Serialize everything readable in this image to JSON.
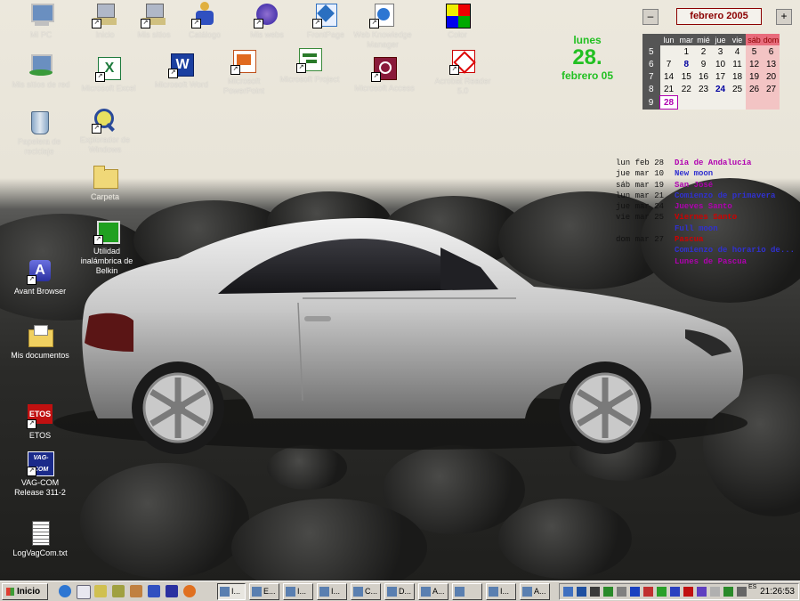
{
  "desktop_icons": [
    {
      "id": "mi-pc",
      "label": "Mi PC",
      "x": 0
    },
    {
      "id": "inicio",
      "label": "Inicio"
    },
    {
      "id": "mis-sitios",
      "label": "Mis sitios"
    },
    {
      "id": "catalogo",
      "label": "Catálogo"
    },
    {
      "id": "mis-webs",
      "label": "Mis webs"
    },
    {
      "id": "frontpage",
      "label": "FrontPage"
    },
    {
      "id": "web-knowledge",
      "label": "Web Knowledge Manager"
    },
    {
      "id": "color",
      "label": "Color"
    },
    {
      "id": "mis-sitios-red",
      "label": "Mis sitios de red"
    },
    {
      "id": "excel",
      "label": "Microsoft Excel"
    },
    {
      "id": "word",
      "label": "Microsoft Word"
    },
    {
      "id": "powerpoint",
      "label": "Microsoft PowerPoint"
    },
    {
      "id": "project",
      "label": "Microsoft Project"
    },
    {
      "id": "access",
      "label": "Microsoft Access"
    },
    {
      "id": "acrobat",
      "label": "Acrobat Reader 5.0"
    },
    {
      "id": "papelera",
      "label": "Papelera de reciclaje"
    },
    {
      "id": "explorador",
      "label": "Explorador de Windows"
    },
    {
      "id": "carpeta",
      "label": "Carpeta"
    },
    {
      "id": "utilidad",
      "label": "Utilidad inalámbrica de Belkin"
    },
    {
      "id": "avant",
      "label": "Avant Browser"
    },
    {
      "id": "mis-documentos",
      "label": "Mis documentos"
    },
    {
      "id": "etos",
      "label": "ETOS",
      "glyph": "ETOS"
    },
    {
      "id": "vagcom",
      "label": "VAG-COM Release 311-2",
      "glyph": "VAG-COM"
    },
    {
      "id": "logvag",
      "label": "LogVagCom.txt"
    }
  ],
  "calendar": {
    "month_label": "febrero 2005",
    "prev": "–",
    "next": "+",
    "weekdays": [
      "lun",
      "mar",
      "mié",
      "jue",
      "vie",
      "sáb",
      "dom"
    ],
    "weeks": [
      {
        "wk": "5",
        "days": [
          "",
          "1",
          "2",
          "3",
          "4",
          "5",
          "6"
        ]
      },
      {
        "wk": "6",
        "days": [
          "7",
          "8",
          "9",
          "10",
          "11",
          "12",
          "13"
        ]
      },
      {
        "wk": "7",
        "days": [
          "14",
          "15",
          "16",
          "17",
          "18",
          "19",
          "20"
        ]
      },
      {
        "wk": "8",
        "days": [
          "21",
          "22",
          "23",
          "24",
          "25",
          "26",
          "27"
        ]
      },
      {
        "wk": "9",
        "days": [
          "28",
          "",
          "",
          "",
          "",
          "",
          ""
        ]
      }
    ],
    "today": "28"
  },
  "big_date": {
    "weekday": "lunes",
    "day": "28.",
    "month_year": "febrero 05"
  },
  "events": [
    {
      "date": "lun  feb 28",
      "text": "Día de Andalucía",
      "color": "#b000b0"
    },
    {
      "date": "jue  mar 10",
      "text": "New moon",
      "color": "#3030d0"
    },
    {
      "date": "sáb  mar 19",
      "text": "San José",
      "color": "#b000b0"
    },
    {
      "date": "lun  mar 21",
      "text": "Comienzo de primavera",
      "color": "#3030d0"
    },
    {
      "date": "jue  mar 24",
      "text": "Jueves Santo",
      "color": "#b000b0"
    },
    {
      "date": "vie  mar 25",
      "text": "Viernes Santo",
      "color": "#d00000"
    },
    {
      "date": "",
      "text": "Full moon",
      "color": "#3030d0"
    },
    {
      "date": "dom  mar 27",
      "text": "Pascua",
      "color": "#d00000"
    },
    {
      "date": "",
      "text": "Comienzo de horario de...",
      "color": "#3030d0"
    },
    {
      "date": "",
      "text": "Lunes de Pascua",
      "color": "#b000b0"
    }
  ],
  "taskbar": {
    "start_label": "Inicio",
    "tasks": [
      "I...",
      "E...",
      "I...",
      "I...",
      "C...",
      "D...",
      "A...",
      "",
      "I...",
      "A..."
    ],
    "clock": "21:26:53",
    "lang": "ES"
  }
}
